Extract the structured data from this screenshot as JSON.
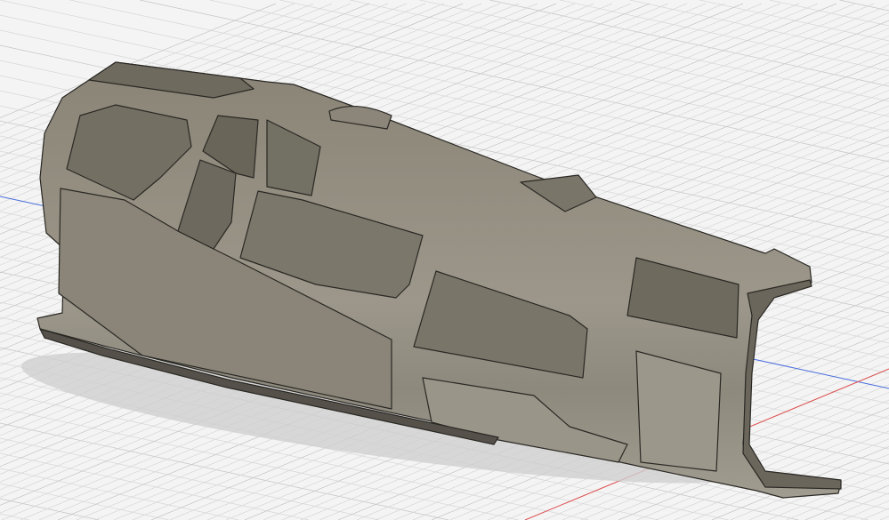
{
  "viewport": {
    "background_color": "#f4f4f4",
    "grid_color": "#d6d6d6",
    "grid_major_color": "#c4c4c4",
    "axis_x_color": "#e05050",
    "axis_y_color": "#4a6ee0",
    "model_color": "#7d776b",
    "model_light_color": "#a8a396",
    "model_dark_color": "#5c574d",
    "edge_color": "#2a2824",
    "shadow_color": "#c9c9c9"
  }
}
